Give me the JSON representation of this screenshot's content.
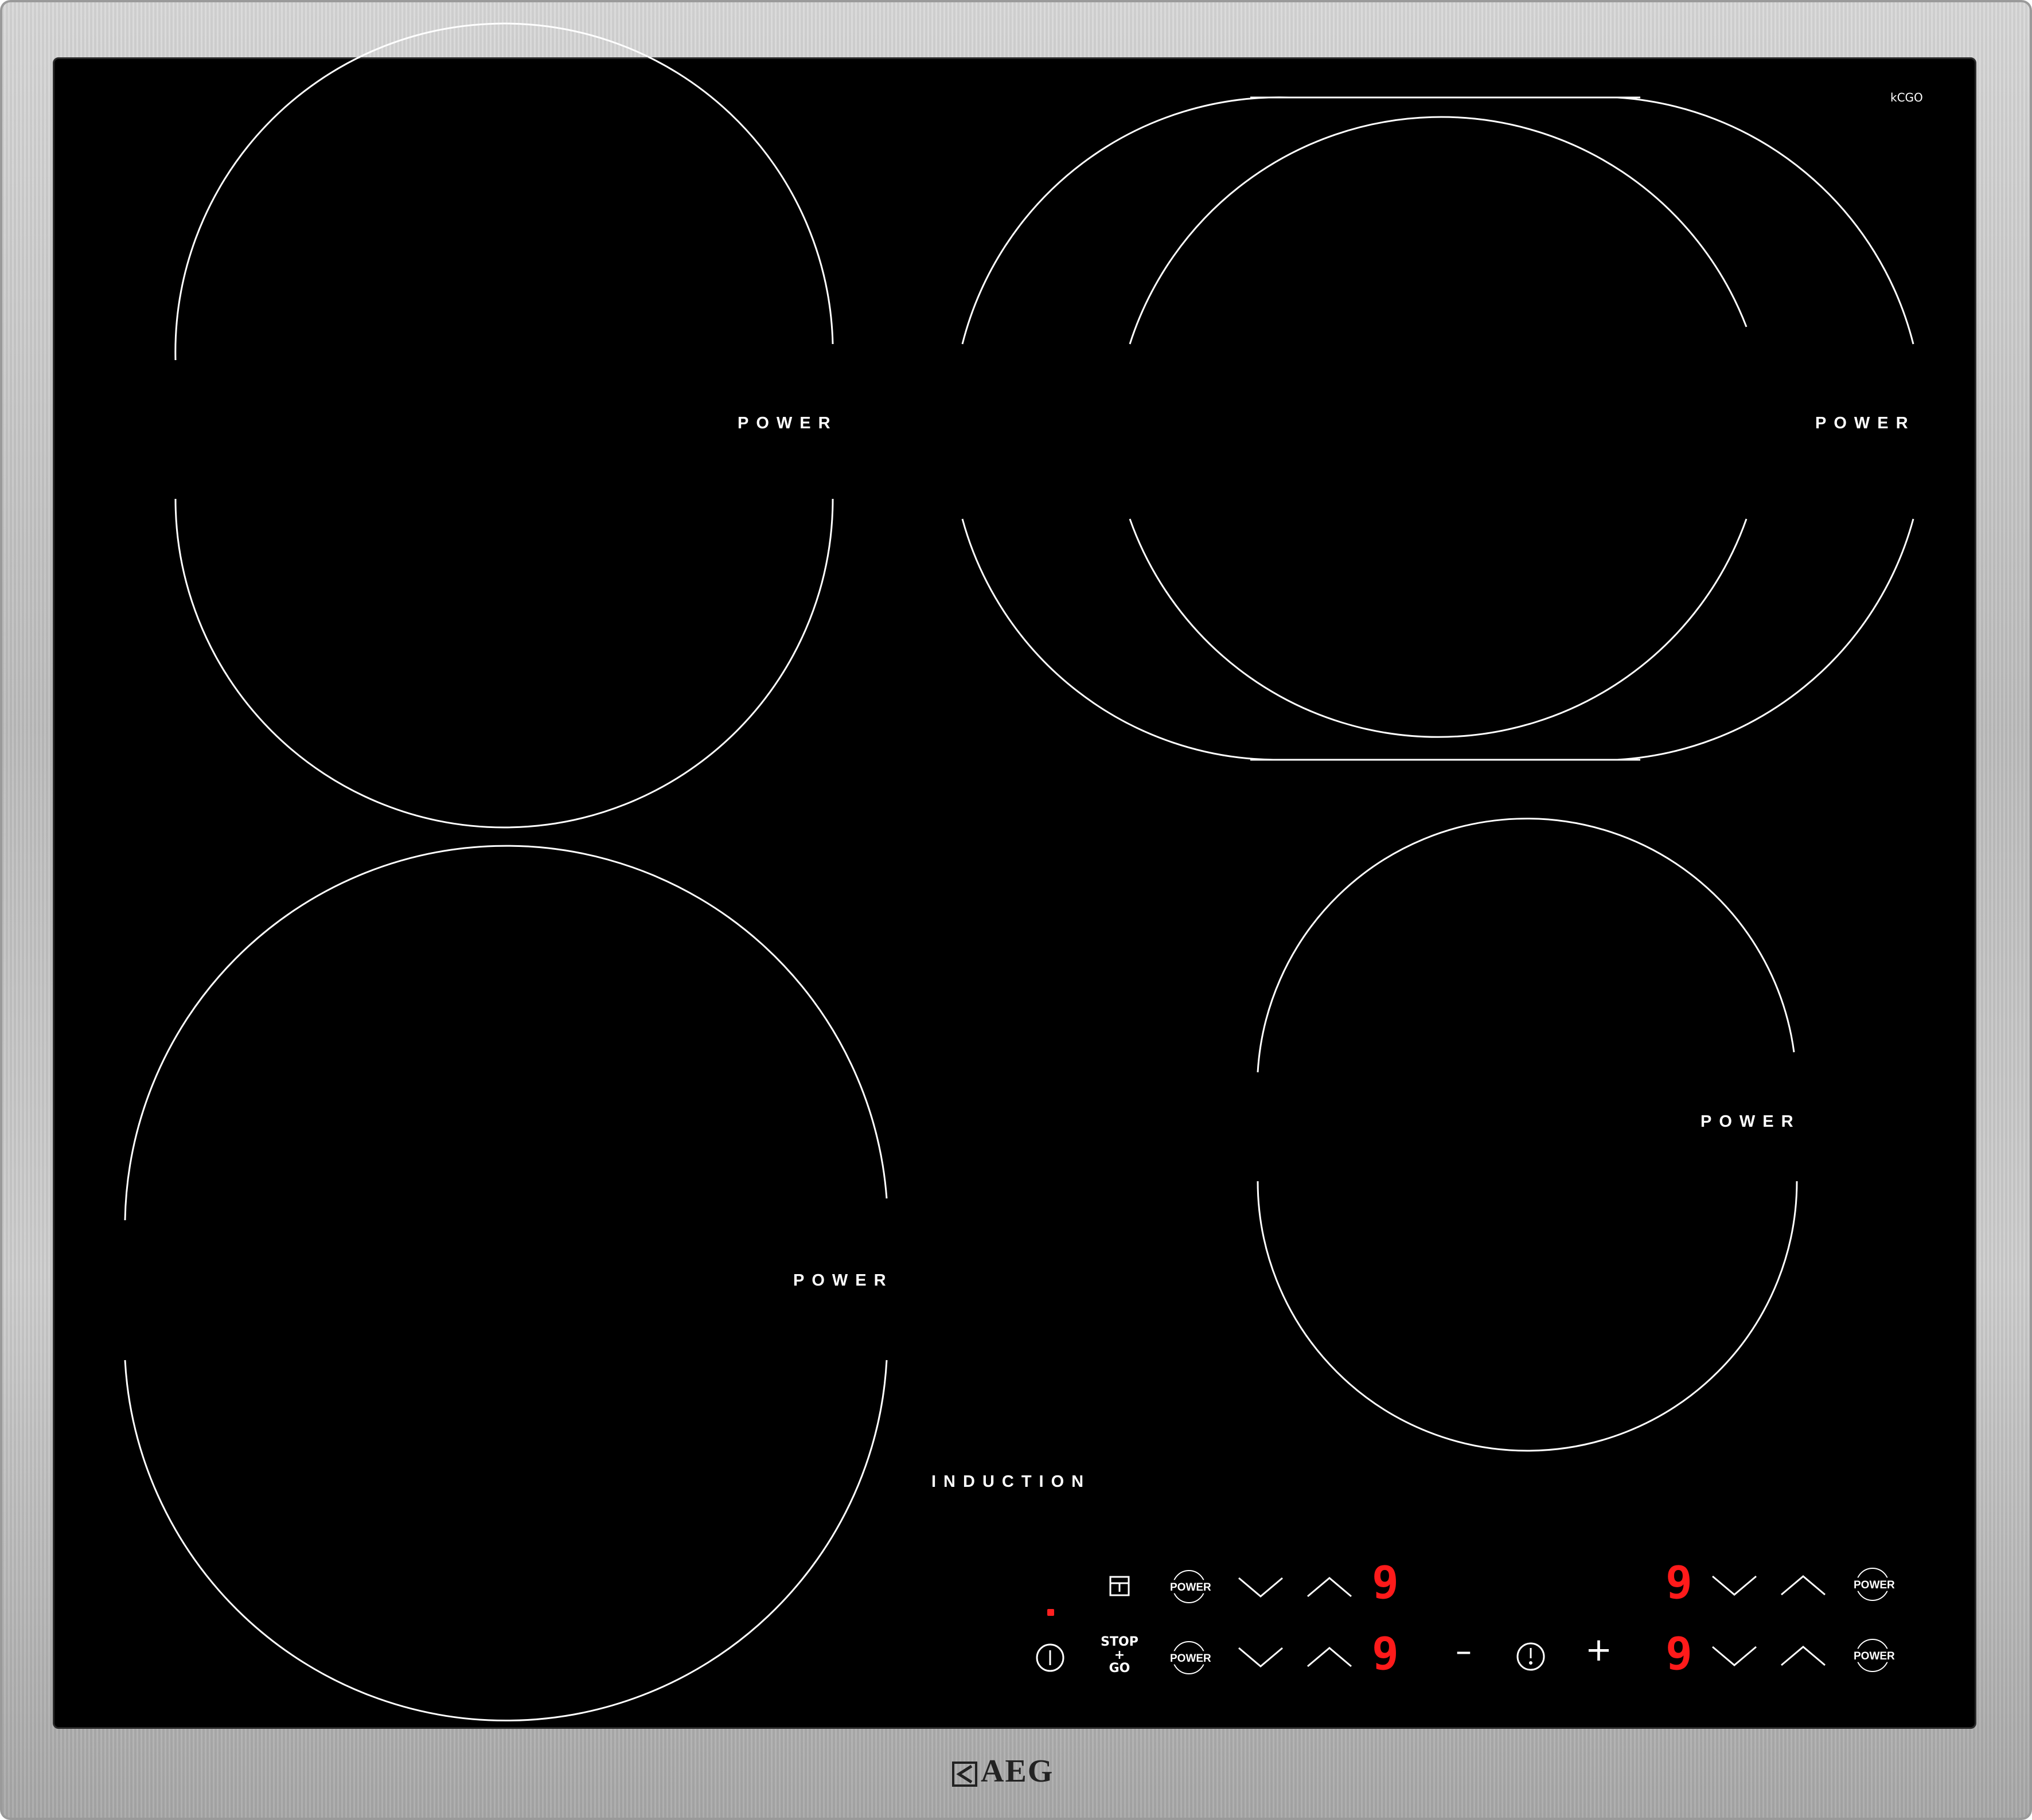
{
  "colors": {
    "glass": "#000000",
    "frame": "#c6c6c6",
    "display": "#ff1a1a",
    "lines": "#ffffff"
  },
  "zones": [
    {
      "label": "POWER"
    },
    {
      "label": "POWER"
    },
    {
      "label": "POWER"
    },
    {
      "label": "POWER"
    }
  ],
  "induction_label": "INDUCTION",
  "mark_text": "kCGO",
  "controls": {
    "power_label": "POWER",
    "stop_go": [
      "STOP",
      "+",
      "GO"
    ],
    "minus": "–",
    "plus": "+",
    "displays": [
      "9",
      "9",
      "9",
      "9"
    ],
    "icons": [
      "lock-icon",
      "on-off-icon",
      "timer-icon",
      "chevron-down-icon",
      "chevron-up-icon"
    ]
  },
  "brand": "AEG"
}
